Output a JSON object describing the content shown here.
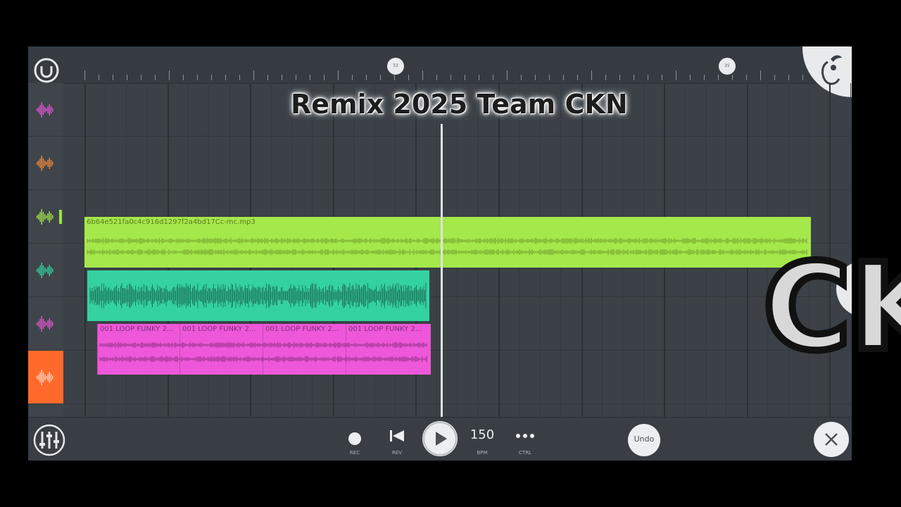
{
  "title_overlay": "Remix 2025 Team CKN",
  "logo_overlay": "CK",
  "ruler": {
    "markers": [
      "33",
      "35"
    ]
  },
  "clips": {
    "green": {
      "name": "6b64e521fa0c4c916d1297f2a4bd17Cc-mc.mp3",
      "color": "#a5e84a"
    },
    "teal": {
      "color": "#34d1a1"
    },
    "pink": {
      "color": "#ee57d9",
      "segments": [
        "001 LOOP FUNKY 2...",
        "001 LOOP FUNKY 2...",
        "001 LOOP FUNKY 2...",
        "001 LOOP FUNKY 2..."
      ]
    }
  },
  "tracks": [
    {
      "icon": "waveform-icon",
      "color": "#e056d3"
    },
    {
      "icon": "waveform-icon",
      "color": "#f08a3a"
    },
    {
      "icon": "waveform-icon",
      "color": "#a5e84a"
    },
    {
      "icon": "waveform-icon",
      "color": "#34d1a1"
    },
    {
      "icon": "waveform-icon",
      "color": "#e056d3"
    },
    {
      "icon": "waveform-icon",
      "color": "#ff6a2b"
    }
  ],
  "transport": {
    "rec_label": "REC",
    "rev_label": "REV",
    "bpm_value": "150",
    "bpm_label": "BPM",
    "ctrl_label": "CTRL",
    "undo_label": "Undo"
  }
}
